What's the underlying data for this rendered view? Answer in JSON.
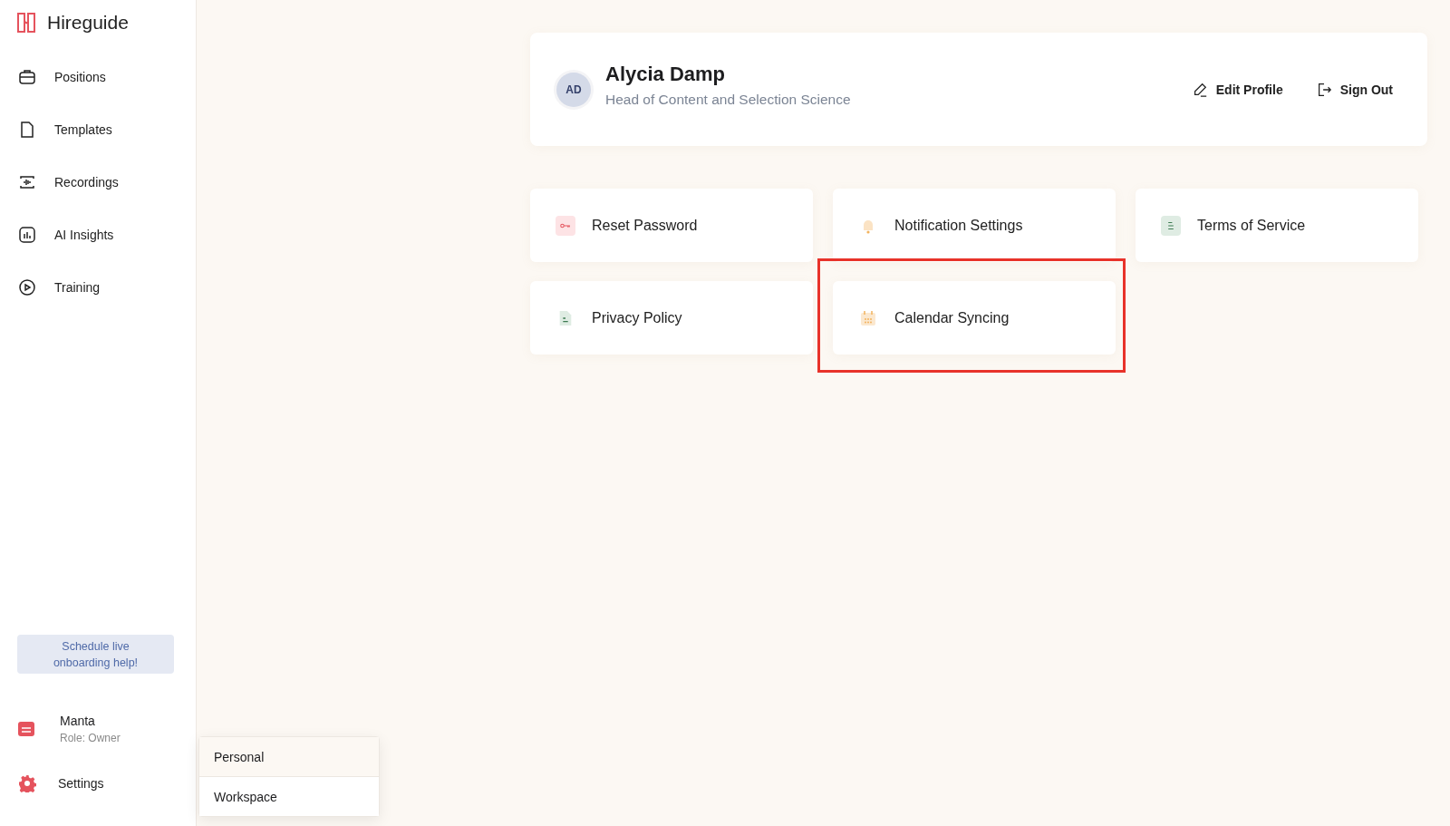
{
  "brand": {
    "name": "Hireguide"
  },
  "sidebar": {
    "items": [
      {
        "label": "Positions",
        "kind": "briefcase",
        "selected": false
      },
      {
        "label": "Templates",
        "kind": "document",
        "selected": false
      },
      {
        "label": "Recordings",
        "kind": "waveform",
        "selected": false
      },
      {
        "label": "AI Insights",
        "kind": "chart",
        "selected": false
      },
      {
        "label": "Training",
        "kind": "play",
        "selected": false
      }
    ],
    "schedule_button": "Schedule live onboarding help!",
    "workspace": {
      "name": "Manta",
      "role": "Role: Owner"
    },
    "settings": "Settings"
  },
  "settings_menu": [
    {
      "label": "Personal",
      "selected": true
    },
    {
      "label": "Workspace",
      "selected": false
    }
  ],
  "profile": {
    "initials": "AD",
    "name": "Alycia Damp",
    "title": "Head of Content and Selection Science",
    "edit": "Edit Profile",
    "sign_out": "Sign Out"
  },
  "tiles": [
    {
      "label": "Reset Password",
      "kind": "key",
      "highlighted": false
    },
    {
      "label": "Notification Settings",
      "kind": "bell",
      "highlighted": false
    },
    {
      "label": "Terms of Service",
      "kind": "lines",
      "highlighted": false
    },
    {
      "label": "Privacy Policy",
      "kind": "file",
      "highlighted": false
    },
    {
      "label": "Calendar Syncing",
      "kind": "calendar",
      "highlighted": true
    }
  ]
}
